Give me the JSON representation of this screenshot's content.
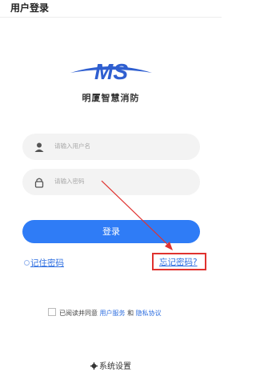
{
  "header": {
    "title": "用户登录"
  },
  "brand": {
    "logo_text": "MS",
    "name": "明厦智慧消防",
    "accent": "#2f5fd0"
  },
  "form": {
    "username_placeholder": "请输入用户名",
    "password_placeholder": "请输入密码",
    "login_label": "登录",
    "remember_label": "记住密码",
    "forgot_label": "忘记密码?"
  },
  "agreement": {
    "prefix": "已阅读并同意",
    "service": "用户服务",
    "and": "和",
    "privacy": "隐私协议"
  },
  "settings": {
    "label": "系统设置"
  },
  "colors": {
    "primary": "#2f7cf6",
    "link": "#2f6fe0",
    "highlight": "#e0322f"
  }
}
